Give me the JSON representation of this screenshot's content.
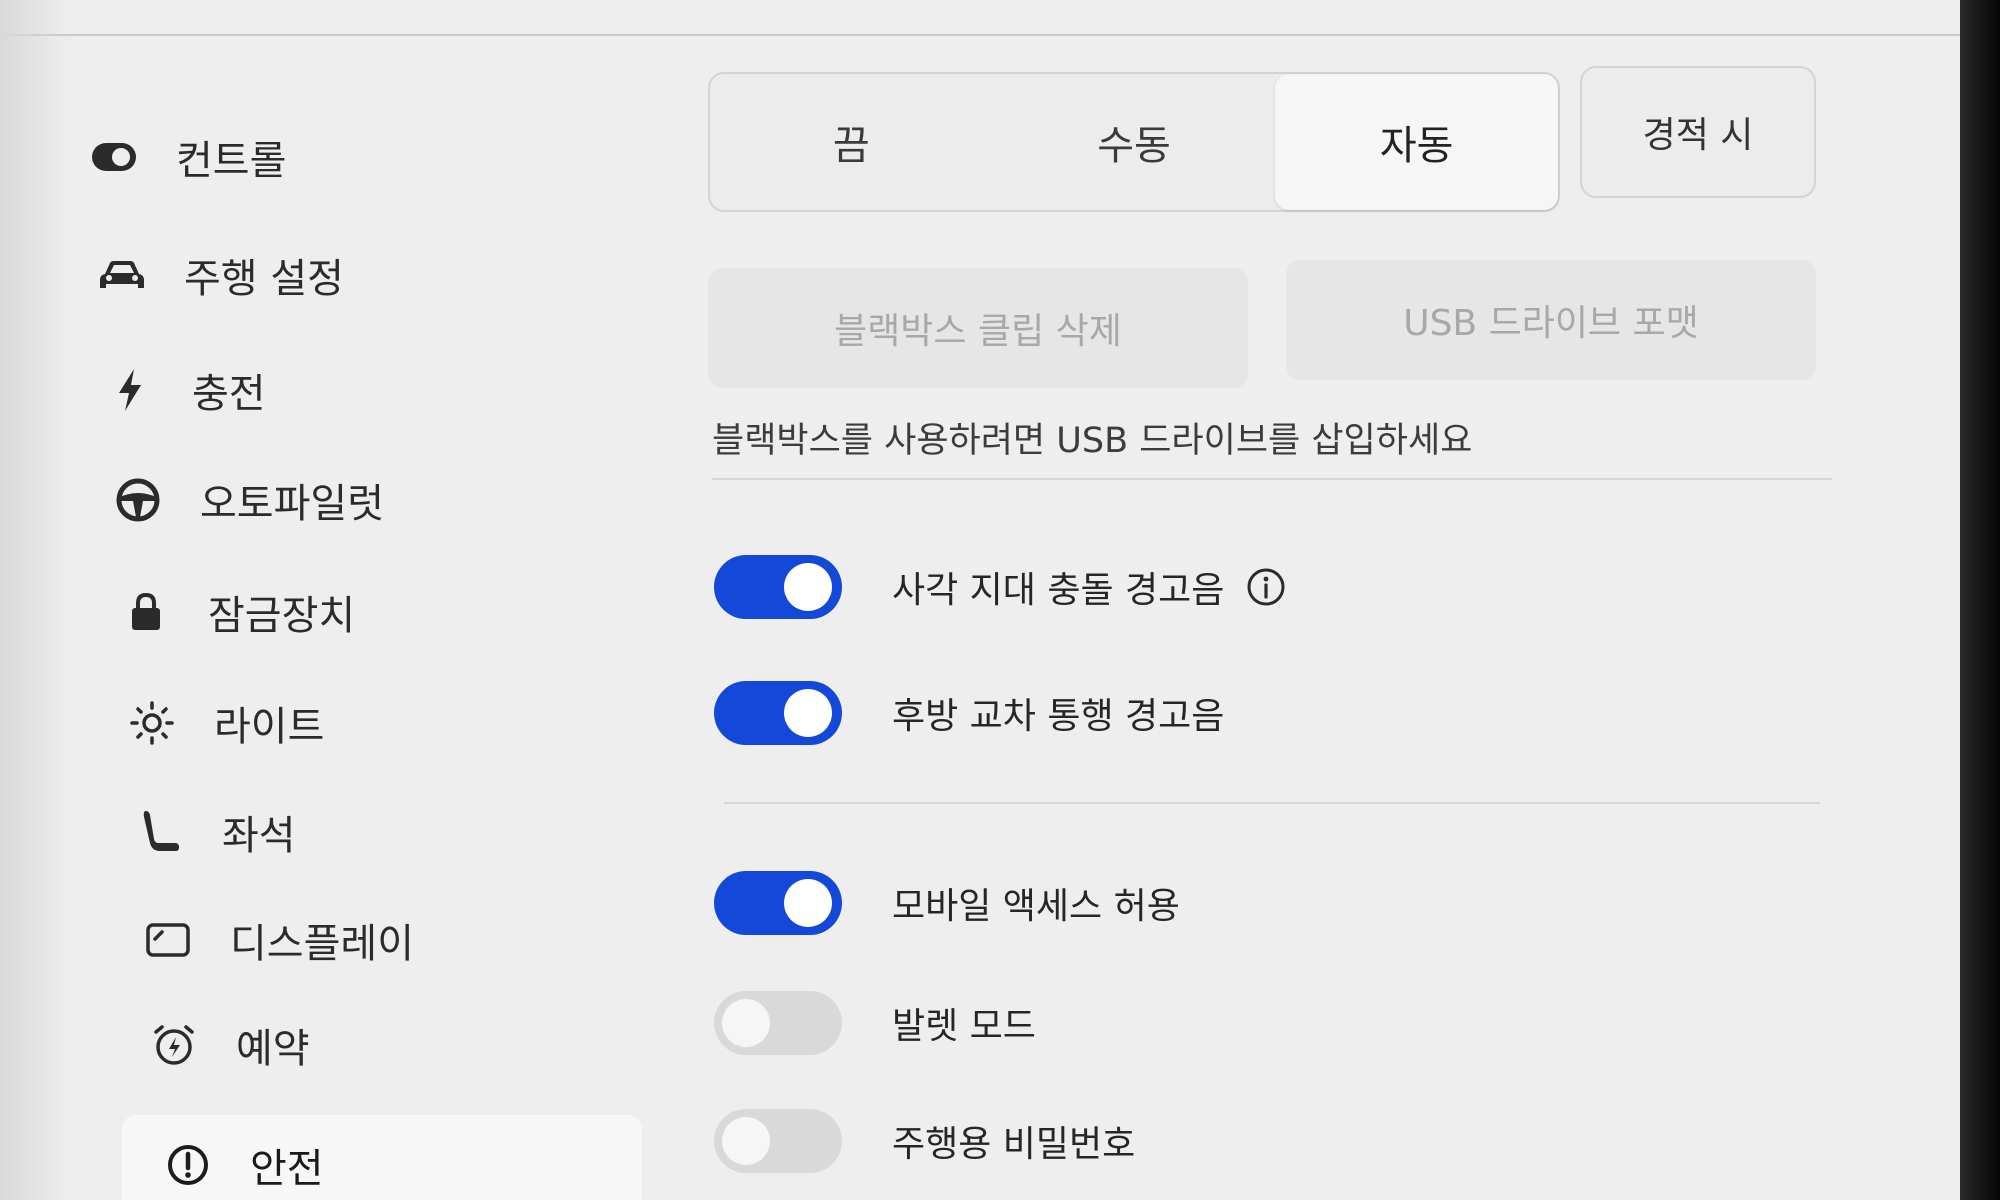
{
  "sidebar": {
    "items": [
      {
        "label": "컨트롤",
        "icon": "toggle-icon"
      },
      {
        "label": "주행 설정",
        "icon": "car-icon"
      },
      {
        "label": "충전",
        "icon": "lightning-icon"
      },
      {
        "label": "오토파일럿",
        "icon": "steering-wheel-icon"
      },
      {
        "label": "잠금장치",
        "icon": "lock-icon"
      },
      {
        "label": "라이트",
        "icon": "sun-icon"
      },
      {
        "label": "좌석",
        "icon": "seat-icon"
      },
      {
        "label": "디스플레이",
        "icon": "display-icon"
      },
      {
        "label": "예약",
        "icon": "alarm-clock-icon"
      },
      {
        "label": "안전",
        "icon": "alert-circle-icon",
        "active": true
      }
    ]
  },
  "dashcam": {
    "modes": [
      "끔",
      "수동",
      "자동"
    ],
    "selected_mode": "자동",
    "sentry_label": "경적 시",
    "delete_clips_label": "블랙박스 클립 삭제",
    "format_usb_label": "USB 드라이브 포맷",
    "hint": "블랙박스를 사용하려면 USB 드라이브를 삽입하세요"
  },
  "toggles": {
    "blind_spot": {
      "label": "사각 지대 충돌 경고음",
      "on": true
    },
    "rear_cross_traffic": {
      "label": "후방 교차 통행 경고음",
      "on": true
    },
    "mobile_access": {
      "label": "모바일 액세스 허용",
      "on": true
    },
    "valet_mode": {
      "label": "발렛 모드",
      "on": false
    },
    "pin_to_drive": {
      "label": "주행용 비밀번호",
      "on": false
    }
  },
  "colors": {
    "toggle_on": "#1448d8",
    "toggle_off": "#d9d9d9",
    "background": "#eeeeee"
  }
}
